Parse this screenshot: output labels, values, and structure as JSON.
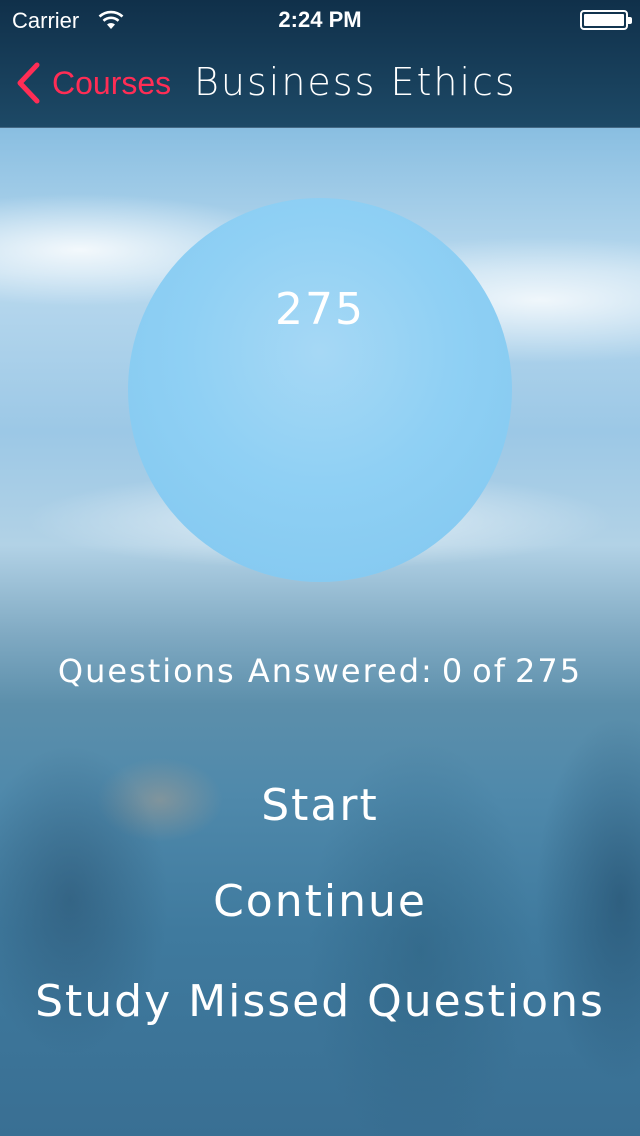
{
  "status_bar": {
    "carrier": "Carrier",
    "time": "2:24 PM",
    "wifi_icon": "wifi-icon",
    "battery_icon": "battery-full-icon"
  },
  "nav": {
    "back_label": "Courses",
    "back_icon": "chevron-left-icon",
    "title": "Business Ethics",
    "accent_color": "#ff2d55"
  },
  "summary": {
    "total_questions": "275",
    "answered_label": "Questions Answered:",
    "answered_count": "0",
    "of_word": "of",
    "answered_total": "275"
  },
  "actions": {
    "start": "Start",
    "continue": "Continue",
    "study_missed": "Study Missed Questions"
  }
}
